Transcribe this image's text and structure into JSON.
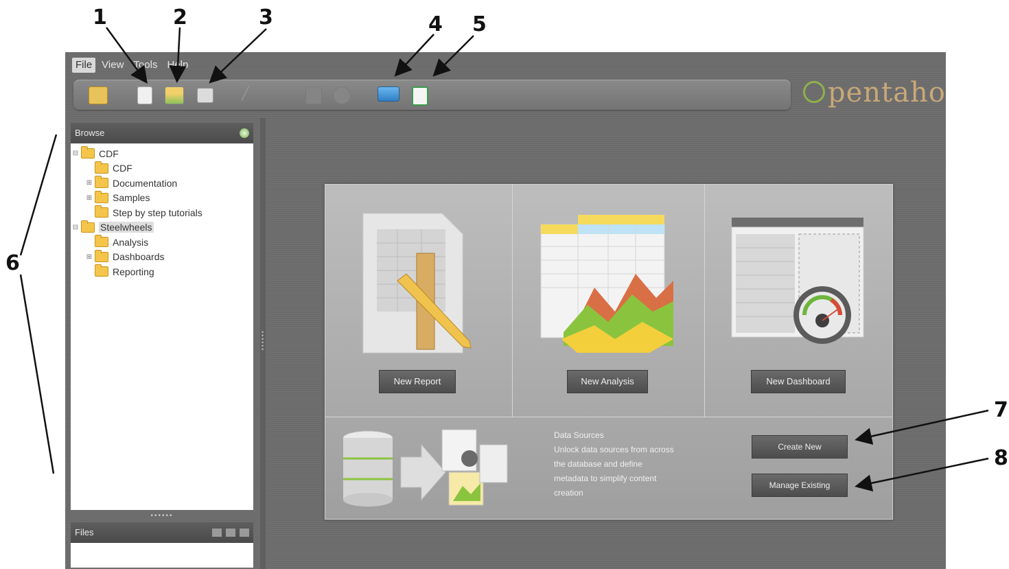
{
  "callouts": [
    "1",
    "2",
    "3",
    "4",
    "5",
    "6",
    "7",
    "8"
  ],
  "menu": {
    "file": "File",
    "view": "View",
    "tools": "Tools",
    "help": "Help"
  },
  "toolbar_icons": [
    "open-folder-icon",
    "new-report-icon",
    "new-analysis-icon",
    "new-dashboard-icon",
    "edit-icon",
    "save-icon",
    "schedule-icon",
    "monitor-icon",
    "spreadsheet-icon"
  ],
  "logo": {
    "text": "pentaho"
  },
  "browse": {
    "title": "Browse",
    "items": [
      {
        "label": "CDF",
        "level": 0,
        "expander": "minus"
      },
      {
        "label": "CDF",
        "level": 1,
        "expander": ""
      },
      {
        "label": "Documentation",
        "level": 1,
        "expander": "plus"
      },
      {
        "label": "Samples",
        "level": 1,
        "expander": "plus"
      },
      {
        "label": "Step by step tutorials",
        "level": 1,
        "expander": ""
      },
      {
        "label": "Steelwheels",
        "level": 0,
        "expander": "minus",
        "selected": true
      },
      {
        "label": "Analysis",
        "level": 1,
        "expander": ""
      },
      {
        "label": "Dashboards",
        "level": 1,
        "expander": "plus"
      },
      {
        "label": "Reporting",
        "level": 1,
        "expander": ""
      }
    ]
  },
  "files": {
    "title": "Files"
  },
  "welcome": {
    "new_report": "New Report",
    "new_analysis": "New Analysis",
    "new_dashboard": "New Dashboard",
    "data_sources_text": "Data Sources\nUnlock data sources from across\nthe database and define\nmetadata to simplify content\ncreation",
    "create_new": "Create New",
    "manage_existing": "Manage Existing"
  },
  "colors": {
    "app_bg": "#6b6b6b",
    "toolbar": "#7f7f7f",
    "folder": "#f4c54a",
    "logo": "#c9a878",
    "accent_green": "#8fb04a"
  }
}
